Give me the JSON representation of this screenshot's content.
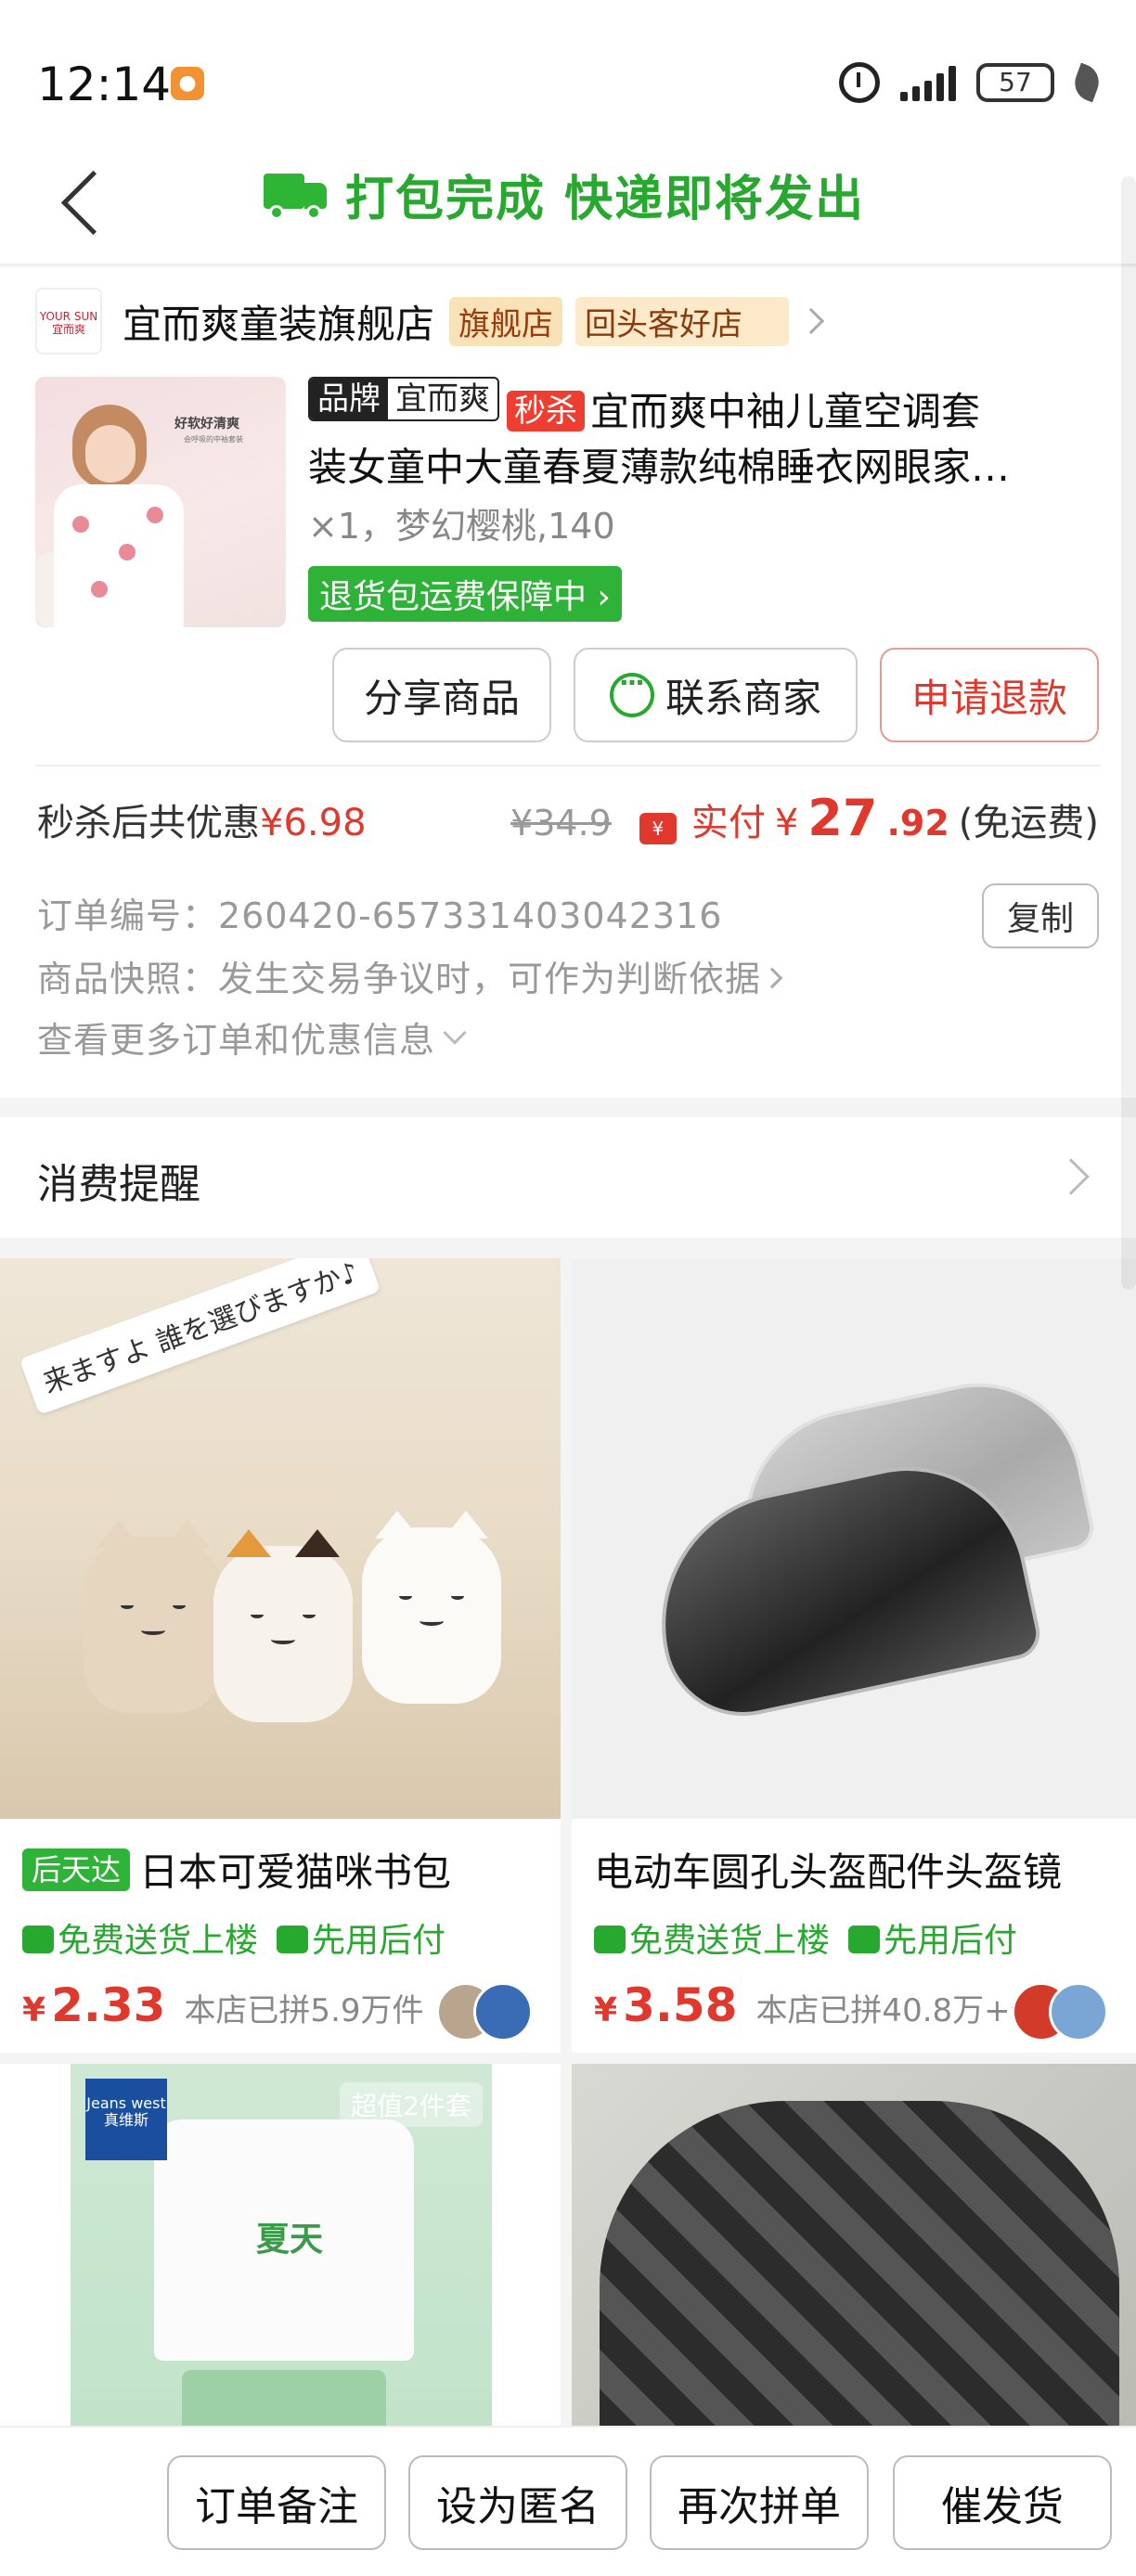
{
  "status_bar": {
    "time": "12:14",
    "battery": "57",
    "app_icon": "chat-bubble-icon"
  },
  "header": {
    "title": "打包完成 快递即将发出",
    "icon": "truck-icon",
    "accent_color": "#27a82e"
  },
  "order": {
    "shop": {
      "logo_text": "YOUR SUN 宜而爽",
      "name": "宜而爽童装旗舰店",
      "badge_flagship": "旗舰店",
      "badge_return": "回头客好店",
      "arrow": "›"
    },
    "product": {
      "brand_key": "品牌",
      "brand_value": "宜而爽",
      "sale_tag": "秒杀",
      "title_line1": "宜而爽中袖儿童空调套",
      "title_line2": "装女童中大童春夏薄款纯棉睡衣网眼家…",
      "spec": "×1，梦幻樱桃,140",
      "guarantee": "退货包运费保障中 ›",
      "img_caption": "好软好清爽",
      "img_subcaption": "会呼吸的中袖套装"
    },
    "actions": {
      "share": "分享商品",
      "contact": "联系商家",
      "refund": "申请退款"
    },
    "pricing": {
      "discount_label": "秒杀后共优惠",
      "discount_value": "¥6.98",
      "original_price": "¥34.9",
      "paid_label": "实付",
      "paid_currency": "¥",
      "paid_amount": "27",
      "paid_cents": ".92",
      "shipping": "(免运费)"
    },
    "info": {
      "order_no": "订单编号：260420-657331403042316",
      "copy_button": "复制",
      "snapshot": "商品快照：发生交易争议时，可作为判断依据",
      "more": "查看更多订单和优惠信息"
    }
  },
  "reminder": {
    "label": "消费提醒"
  },
  "recommendations": [
    {
      "badge": "后天达",
      "title": "日本可爱猫咪书包",
      "tag1": "免费送货上楼",
      "tag2": "先用后付",
      "currency": "¥",
      "price": "2.33",
      "sold": "本店已拼5.9万件",
      "img_text": "来ますよ 誰を選びますか♪"
    },
    {
      "badge": "",
      "title": "电动车圆孔头盔配件头盔镜",
      "tag1": "免费送货上楼",
      "tag2": "先用后付",
      "currency": "¥",
      "price": "3.58",
      "sold": "本店已拼40.8万+件"
    },
    {
      "brand": "Jeans west 真维斯",
      "set_badge": "超值2件套",
      "shirt_text": "夏天"
    },
    {}
  ],
  "bottom_bar": {
    "note": "订单备注",
    "anonymous": "设为匿名",
    "rebuy": "再次拼单",
    "urge": "催发货"
  }
}
